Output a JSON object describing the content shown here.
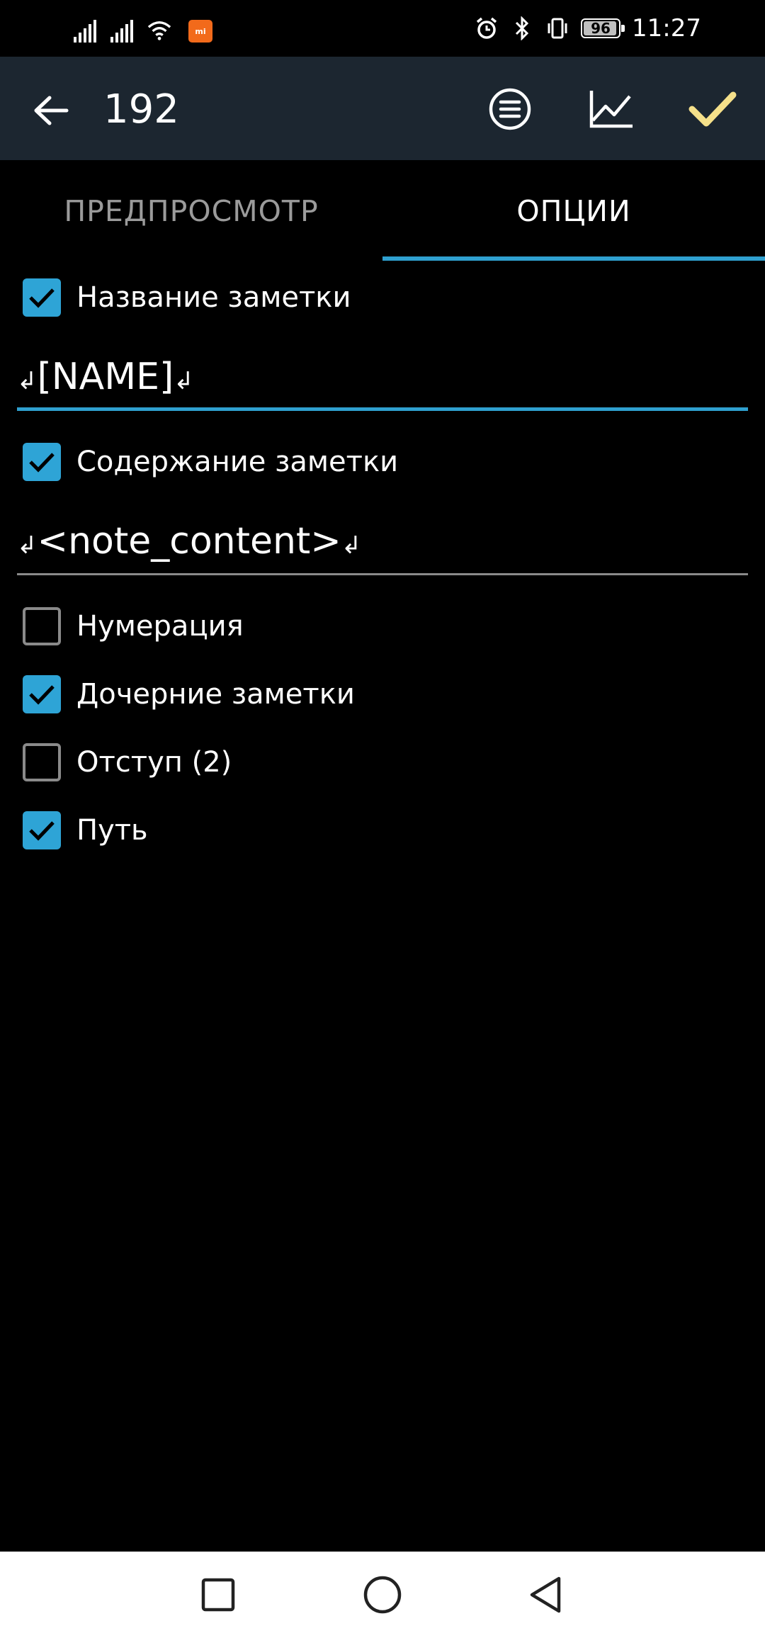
{
  "status_bar": {
    "time": "11:27",
    "battery": "96",
    "battery_level": 0.96,
    "app_badge": "mi"
  },
  "toolbar": {
    "title": "192",
    "back_icon": "arrow-left-icon",
    "menu_icon": "list-circle-icon",
    "chart_icon": "line-chart-icon",
    "confirm_icon": "check-icon",
    "confirm_color": "#f5e08a"
  },
  "tabs": [
    {
      "label": "ПРЕДПРОСМОТР",
      "active": false
    },
    {
      "label": "ОПЦИИ",
      "active": true
    }
  ],
  "accent_color": "#2ea4d6",
  "options": {
    "note_name": {
      "label": "Название заметки",
      "checked": true
    },
    "name_template": {
      "prefix": "↲",
      "value": "[NAME]",
      "suffix": "↲"
    },
    "note_content": {
      "label": "Содержание заметки",
      "checked": true
    },
    "content_template": {
      "prefix": "↲",
      "value": "<note_content>",
      "suffix": "↲"
    },
    "numbering": {
      "label": "Нумерация",
      "checked": false
    },
    "child_notes": {
      "label": "Дочерние заметки",
      "checked": true
    },
    "indent": {
      "label": "Отступ (2)",
      "checked": false
    },
    "path": {
      "label": "Путь",
      "checked": true
    }
  },
  "navbar": {
    "recents_icon": "square-icon",
    "home_icon": "circle-icon",
    "back_icon": "triangle-back-icon"
  }
}
